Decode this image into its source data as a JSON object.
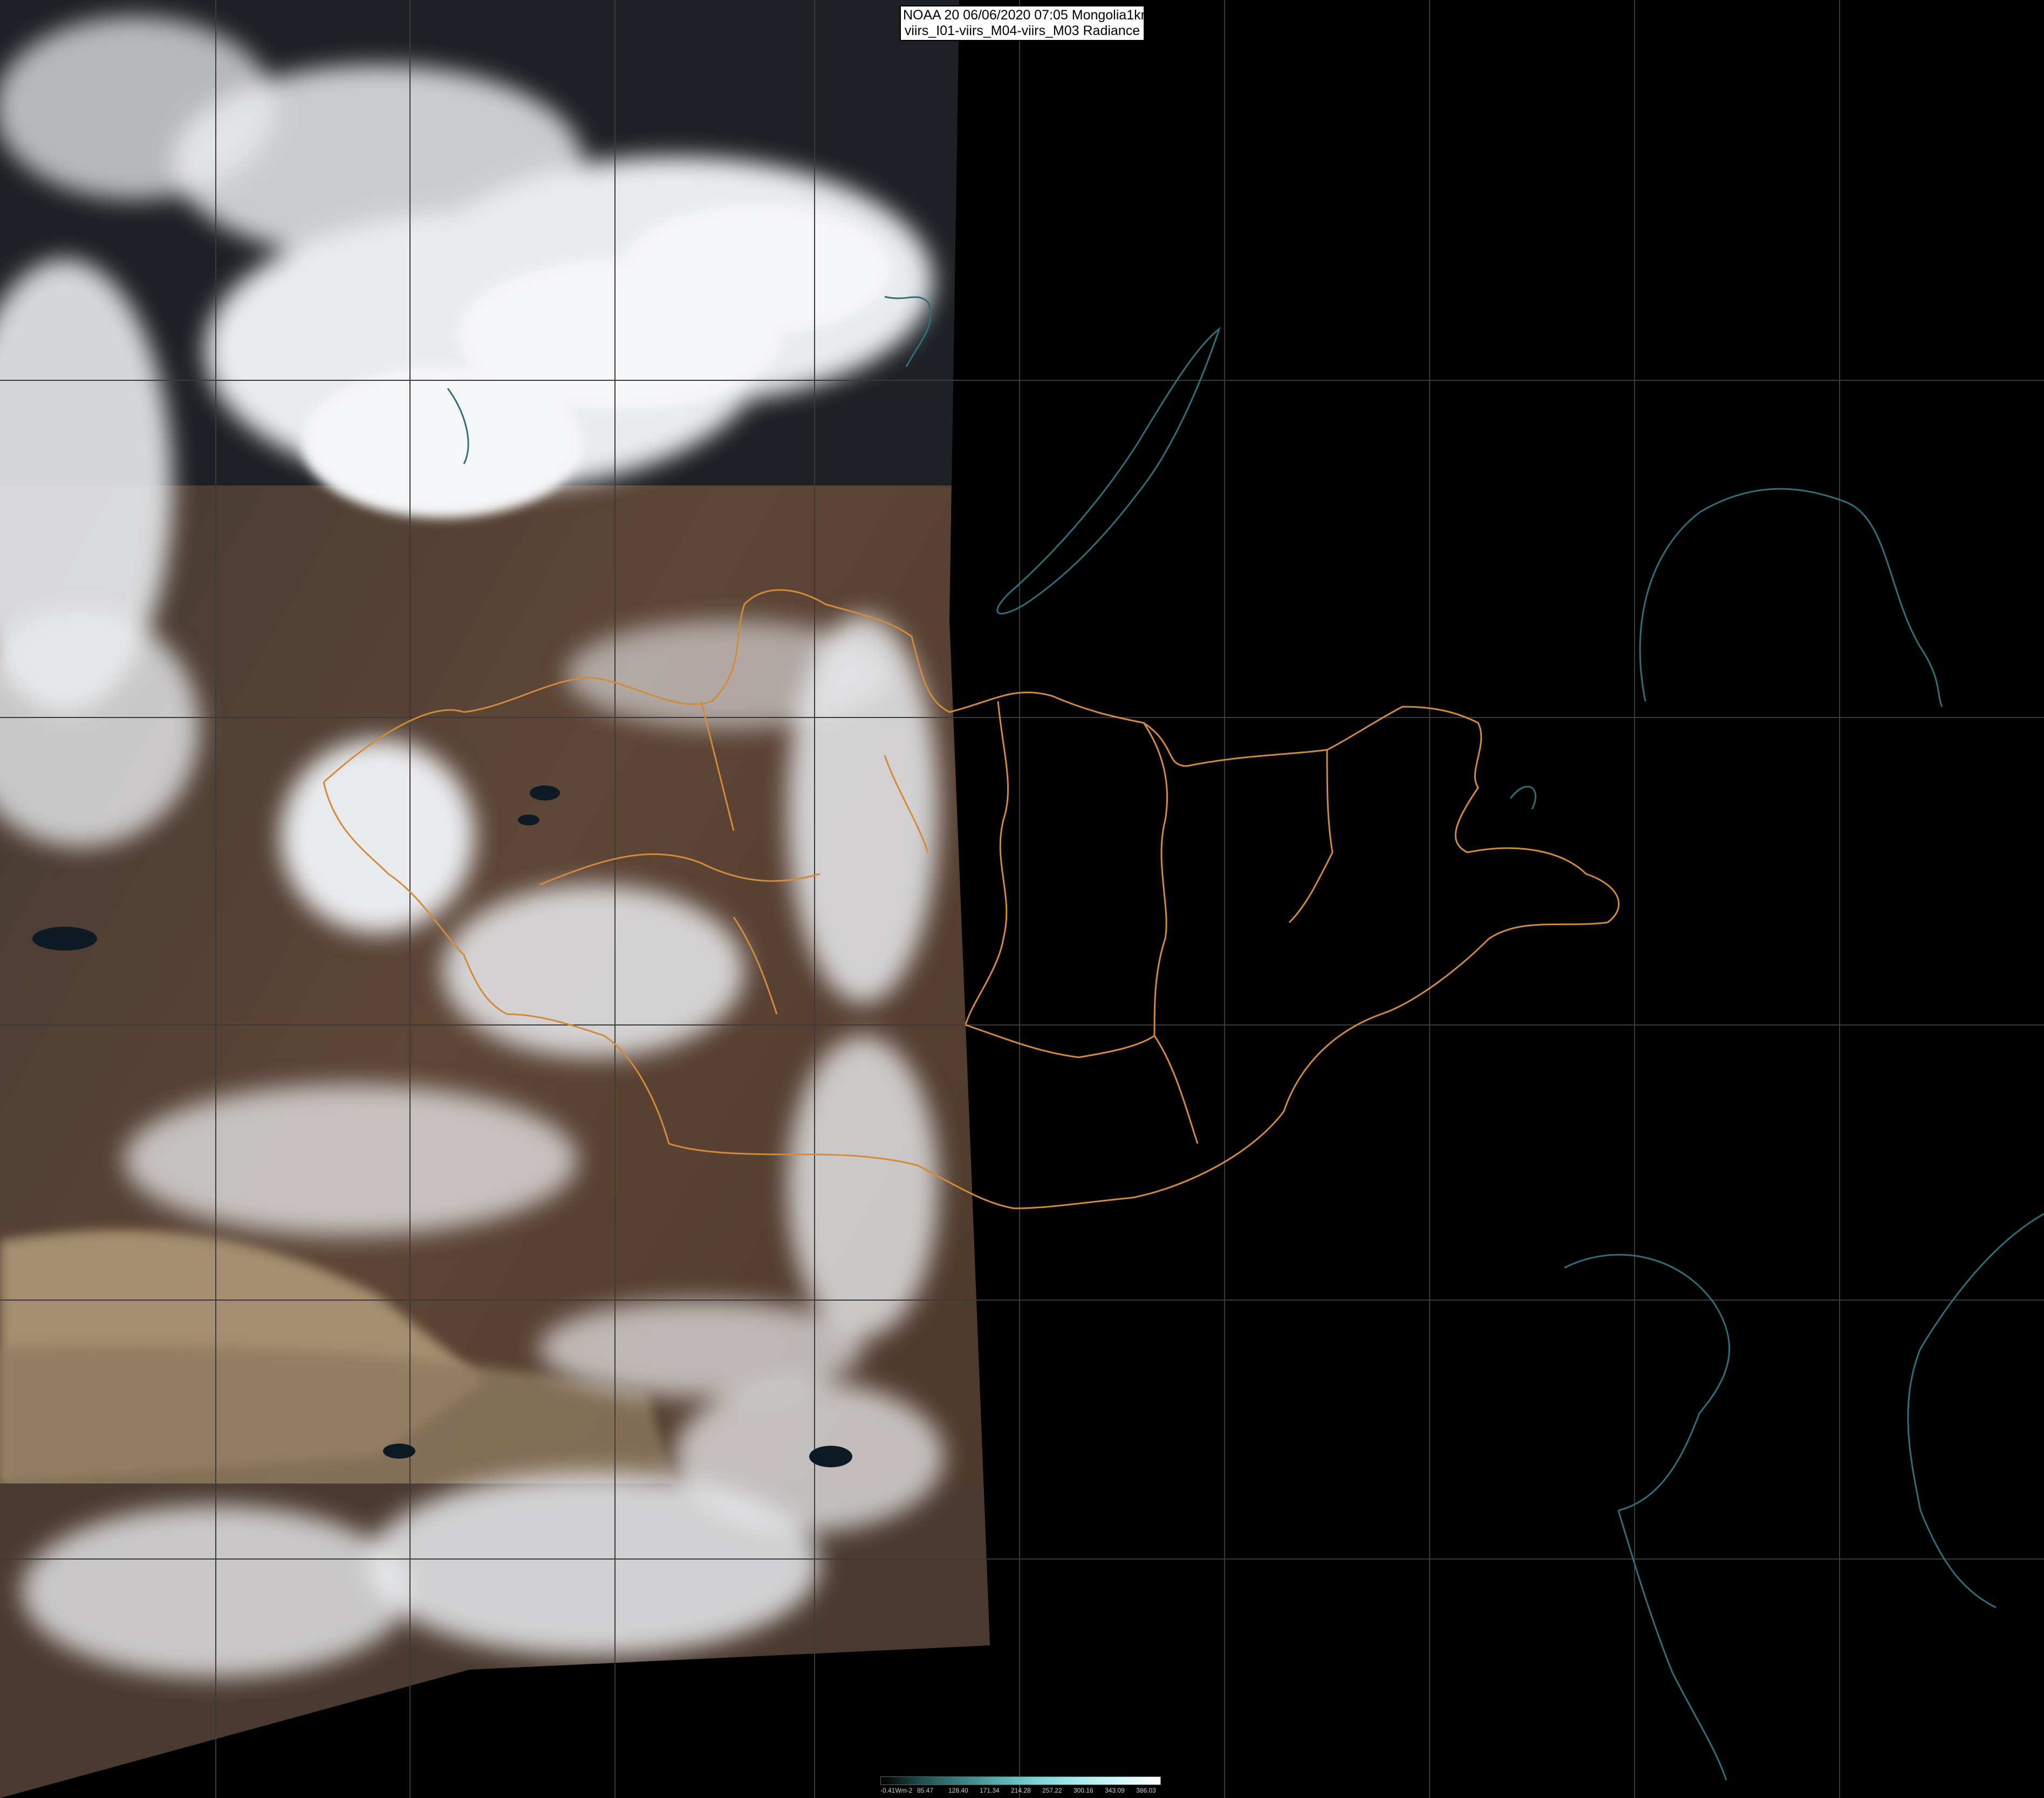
{
  "header": {
    "line1": "NOAA 20 06/06/2020 07:05 Mongolia1km",
    "line2": "viirs_I01-viirs_M04-viirs_M03 Radiance"
  },
  "legend": {
    "ticks": [
      "-0.41Wm-2",
      "85.47",
      "128.40",
      "171.34",
      "214.28",
      "257.22",
      "300.16",
      "343.09",
      "386.03"
    ],
    "colors": [
      "#000000",
      "#1f4f4f",
      "#3a8080",
      "#58b0b0",
      "#7fd6d6",
      "#a8ecec",
      "#d2f7f7",
      "#ffffff"
    ]
  },
  "image": {
    "background": "#000000",
    "swath_note_colors": {
      "cloud": "#e8eaee",
      "land": "#5a4434",
      "desert": "#a89274",
      "border": "#d28a3c",
      "coast": "#2f6f7a",
      "grid": "#3a3a3a"
    }
  }
}
